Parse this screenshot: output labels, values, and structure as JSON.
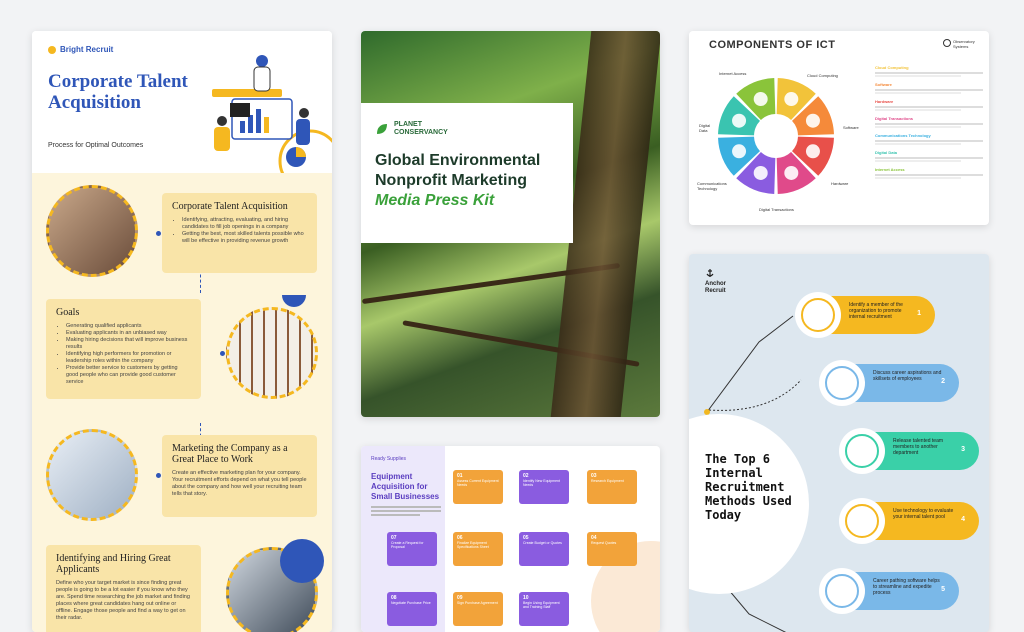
{
  "card1": {
    "brand": "Bright Recruit",
    "title": "Corporate Talent Acquisition",
    "subtitle": "Process for Optimal Outcomes",
    "sections": [
      {
        "title": "Corporate Talent Acquisition",
        "bullets": [
          "Identifying, attracting, evaluating, and hiring candidates to fill job openings in a company",
          "Getting the best, most skilled talents possible who will be effective in providing revenue growth"
        ]
      },
      {
        "title": "Goals",
        "bullets": [
          "Generating qualified applicants",
          "Evaluating applicants in an unbiased way",
          "Making hiring decisions that will improve business results",
          "Identifying high performers for promotion or leadership roles within the company",
          "Provide better service to customers by getting good people who can provide good customer service"
        ]
      },
      {
        "title": "Marketing the Company as a Great Place to Work",
        "text": "Create an effective marketing plan for your company. Your recruitment efforts depend on what you tell people about the company and how well your recruiting team tells that story."
      },
      {
        "title": "Identifying and Hiring Great Applicants",
        "text": "Define who your target market is since finding great people is going to be a lot easier if you know who they are. Spend time researching the job market and finding places where great candidates hang out online or offline. Engage those people and find a way to get on their radar."
      }
    ]
  },
  "card2": {
    "org_line1": "PLANET",
    "org_line2": "CONSERVANCY",
    "title": "Global Environmental Nonprofit Marketing",
    "title_accent": "Media Press Kit"
  },
  "card3": {
    "brand": "Ready Supplies",
    "title": "Equipment Acquisition for Small Businesses",
    "steps": [
      {
        "n": "01",
        "label": "Assess Current Equipment Needs"
      },
      {
        "n": "02",
        "label": "Identify New Equipment Needs"
      },
      {
        "n": "03",
        "label": "Research Equipment"
      },
      {
        "n": "04",
        "label": "Request Quotes"
      },
      {
        "n": "05",
        "label": "Create Budget or Quotes"
      },
      {
        "n": "06",
        "label": "Finalize Equipment Specifications Sheet"
      },
      {
        "n": "07",
        "label": "Create a Request for Proposal"
      },
      {
        "n": "08",
        "label": "Negotiate Purchase Price"
      },
      {
        "n": "09",
        "label": "Sign Purchase Agreement"
      },
      {
        "n": "10",
        "label": "Begin Using Equipment and Training Staff"
      }
    ]
  },
  "card4": {
    "title": "COMPONENTS OF ICT",
    "logo_line1": "Observatory",
    "logo_line2": "Systems",
    "segments": [
      "Internet Access",
      "Cloud Computing",
      "Software",
      "Hardware",
      "Digital Transactions",
      "Communications Technology",
      "Digital Data"
    ],
    "legend": [
      "Cloud Computing",
      "Software",
      "Hardware",
      "Digital Transactions",
      "Communications Technology",
      "Digital Data",
      "Internet Access"
    ],
    "colors": [
      "#f2c33a",
      "#f58a3a",
      "#e8504a",
      "#e04a8a",
      "#8a5ce0",
      "#3ab0e0",
      "#3ac4b0",
      "#8ac43a"
    ]
  },
  "card5": {
    "brand_line1": "Anchor",
    "brand_line2": "Recruit",
    "title": "The Top 6 Internal Recruitment Methods Used Today",
    "items": [
      {
        "n": "1",
        "text": "Identify a member of the organization to promote internal recruitment"
      },
      {
        "n": "2",
        "text": "Discuss career aspirations and skillsets of employees"
      },
      {
        "n": "3",
        "text": "Release talented team members to another department"
      },
      {
        "n": "4",
        "text": "Use technology to evaluate your internal talent pool"
      },
      {
        "n": "5",
        "text": "Career pathing software helps to streamline and expedite process"
      }
    ]
  }
}
